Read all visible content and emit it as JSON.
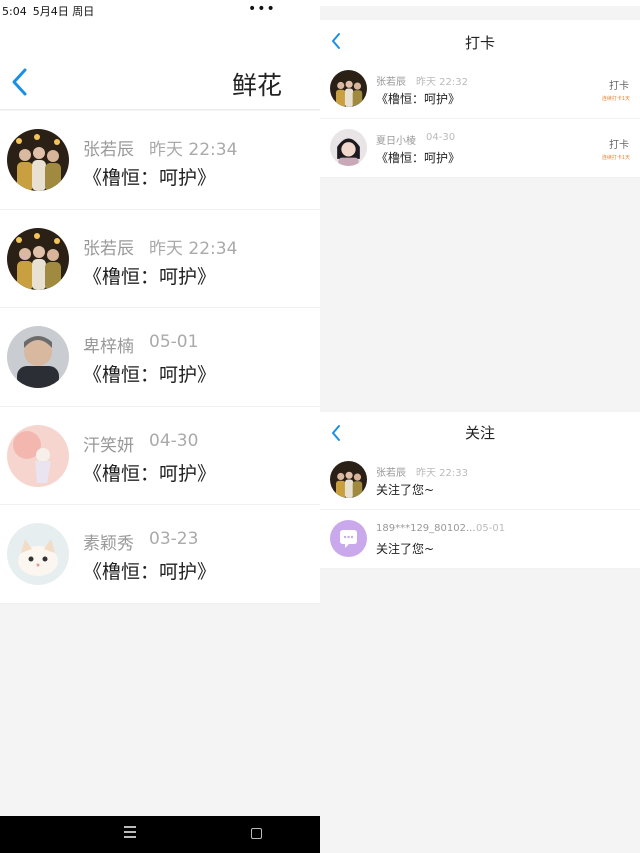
{
  "left": {
    "status_bar": {
      "time": "5:04",
      "date": "5月4日 周日",
      "more": "•••"
    },
    "header": {
      "title": "鲜花"
    },
    "rows": [
      {
        "name": "张若辰",
        "time": "昨天 22:34",
        "message": "《橹恒：呵护》",
        "avatar": "photo-group"
      },
      {
        "name": "张若辰",
        "time": "昨天 22:34",
        "message": "《橹恒：呵护》",
        "avatar": "photo-group"
      },
      {
        "name": "卑梓楠",
        "time": "05-01",
        "message": "《橹恒：呵护》",
        "avatar": "photo-man"
      },
      {
        "name": "汗笑妍",
        "time": "04-30",
        "message": "《橹恒：呵护》",
        "avatar": "photo-pink"
      },
      {
        "name": "素颖秀",
        "time": "03-23",
        "message": "《橹恒：呵护》",
        "avatar": "photo-kitten"
      }
    ]
  },
  "right_checkin": {
    "header": {
      "title": "打卡"
    },
    "rows": [
      {
        "name": "张若辰",
        "time": "昨天 22:32",
        "message": "《橹恒：呵护》",
        "action": "打卡",
        "streak": "连续打卡1天",
        "avatar": "photo-group"
      },
      {
        "name": "夏日小棱",
        "time": "04-30",
        "message": "《橹恒：呵护》",
        "action": "打卡",
        "streak": "连续打卡1天",
        "avatar": "photo-girl"
      }
    ]
  },
  "right_follow": {
    "header": {
      "title": "关注"
    },
    "rows": [
      {
        "name": "张若辰",
        "time": "昨天 22:33",
        "message": "关注了您~",
        "avatar": "photo-group"
      },
      {
        "name": "189***129_80102...",
        "time": "05-01",
        "message": "关注了您~",
        "avatar": "default-chat-icon"
      }
    ]
  },
  "colors": {
    "accent_blue": "#1a8fe3",
    "streak_orange": "#e8873a",
    "default_avatar_purple": "#c9a8ec"
  }
}
